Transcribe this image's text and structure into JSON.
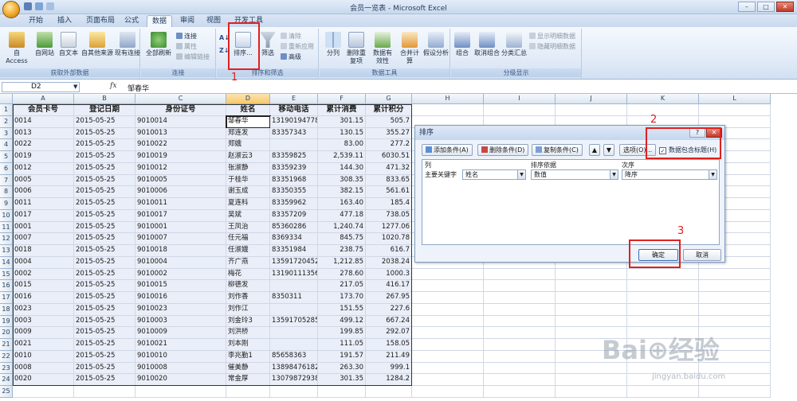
{
  "window": {
    "title": "会员一览表 - Microsoft Excel"
  },
  "ribbon_tabs": [
    "开始",
    "插入",
    "页面布局",
    "公式",
    "数据",
    "审阅",
    "视图",
    "开发工具"
  ],
  "active_tab": "数据",
  "ribbon": {
    "groups": {
      "external": "获取外部数据",
      "connections": "连接",
      "sortfilter": "排序和筛选",
      "datatools": "数据工具",
      "outline": "分级显示"
    },
    "buttons": {
      "from_access": "自 Access",
      "from_web": "自网站",
      "from_text": "自文本",
      "from_other": "自其他来源",
      "existing": "现有连接",
      "refresh_all": "全部刷新",
      "connections": "连接",
      "properties": "属性",
      "edit_links": "编辑链接",
      "sort": "排序...",
      "filter": "筛选",
      "clear": "清除",
      "reapply": "重新应用",
      "advanced": "高级",
      "split": "分列",
      "remove_dup": "删除重复项",
      "validation": "数据有效性",
      "consolidate": "合并计算",
      "whatif": "假设分析",
      "group": "组合",
      "ungroup": "取消组合",
      "subtotal": "分类汇总",
      "show_detail": "显示明细数据",
      "hide_detail": "隐藏明细数据"
    }
  },
  "formula_bar": {
    "name_box": "D2",
    "fx": "fx",
    "content": "邹春华"
  },
  "columns": [
    "A",
    "B",
    "C",
    "D",
    "E",
    "F",
    "G",
    "H",
    "I",
    "J",
    "K",
    "L"
  ],
  "headers": [
    "会员卡号",
    "登记日期",
    "身份证号",
    "姓名",
    "移动电话",
    "累计消费",
    "累计积分"
  ],
  "rows": [
    [
      "0014",
      "2015-05-25",
      "9010014",
      "邹春华",
      "13190194778",
      "301.15",
      "505.7"
    ],
    [
      "0013",
      "2015-05-25",
      "9010013",
      "郑连发",
      "83357343",
      "130.15",
      "355.27"
    ],
    [
      "0022",
      "2015-05-25",
      "9010022",
      "郑娥",
      "",
      "83.00",
      "277.2"
    ],
    [
      "0019",
      "2015-05-25",
      "9010019",
      "赵淑云3",
      "83359825",
      "2,539.11",
      "6030.51"
    ],
    [
      "0012",
      "2015-05-25",
      "9010012",
      "张淑静",
      "83359239",
      "144.30",
      "471.32"
    ],
    [
      "0005",
      "2015-05-25",
      "9010005",
      "于桂华",
      "83351968",
      "308.35",
      "833.65"
    ],
    [
      "0006",
      "2015-05-25",
      "9010006",
      "谢玉成",
      "83350355",
      "382.15",
      "561.61"
    ],
    [
      "0011",
      "2015-05-25",
      "9010011",
      "夏连科",
      "83359962",
      "163.40",
      "185.4"
    ],
    [
      "0017",
      "2015-05-25",
      "9010017",
      "吴斌",
      "83357209",
      "477.18",
      "738.05"
    ],
    [
      "0001",
      "2015-05-25",
      "9010001",
      "王凤治",
      "85360286",
      "1,240.74",
      "1277.06"
    ],
    [
      "0007",
      "2015-05-25",
      "9010007",
      "任元福",
      "8369334",
      "845.75",
      "1020.78"
    ],
    [
      "0018",
      "2015-05-25",
      "9010018",
      "任淑娥",
      "83351984",
      "238.75",
      "616.7"
    ],
    [
      "0004",
      "2015-05-25",
      "9010004",
      "齐广燕",
      "13591720452",
      "1,212.85",
      "2038.24"
    ],
    [
      "0002",
      "2015-05-25",
      "9010002",
      "梅花",
      "13190111356",
      "278.60",
      "1000.3"
    ],
    [
      "0015",
      "2015-05-25",
      "9010015",
      "柳德发",
      "",
      "217.05",
      "416.17"
    ],
    [
      "0016",
      "2015-05-25",
      "9010016",
      "刘作香",
      "8350311",
      "173.70",
      "267.95"
    ],
    [
      "0023",
      "2015-05-25",
      "9010023",
      "刘作江",
      "",
      "151.55",
      "227.6"
    ],
    [
      "0003",
      "2015-05-25",
      "9010003",
      "刘金玲3",
      "13591705285",
      "499.12",
      "667.24"
    ],
    [
      "0009",
      "2015-05-25",
      "9010009",
      "刘洪桥",
      "",
      "199.85",
      "292.07"
    ],
    [
      "0021",
      "2015-05-25",
      "9010021",
      "刘本刚",
      "",
      "111.05",
      "158.05"
    ],
    [
      "0010",
      "2015-05-25",
      "9010010",
      "李兆勤1",
      "85658363",
      "191.57",
      "211.49"
    ],
    [
      "0008",
      "2015-05-25",
      "9010008",
      "催美静",
      "13898476182",
      "263.30",
      "999.1"
    ],
    [
      "0020",
      "2015-05-25",
      "9010020",
      "常金厚",
      "13079872938",
      "301.35",
      "1284.2"
    ]
  ],
  "row_numbers": [
    "1",
    "2",
    "3",
    "4",
    "5",
    "6",
    "7",
    "8",
    "9",
    "10",
    "11",
    "12",
    "13",
    "14",
    "15",
    "16",
    "17",
    "18",
    "19",
    "20",
    "21",
    "22",
    "23",
    "24",
    "25"
  ],
  "dialog": {
    "title": "排序",
    "add_level": "添加条件(A)",
    "delete_level": "删除条件(D)",
    "copy_level": "复制条件(C)",
    "options": "选项(O)...",
    "has_headers": "数据包含标题(H)",
    "col_header": "列",
    "sort_on_header": "排序依据",
    "order_header": "次序",
    "primary_key": "主要关键字",
    "key_value": "姓名",
    "sort_on_value": "数值",
    "order_value": "降序",
    "ok": "确定",
    "cancel": "取消"
  },
  "annotations": {
    "one": "1",
    "two": "2",
    "three": "3"
  },
  "watermark": {
    "main": "Bai⊕经验",
    "sub": "jingyan.baidu.com"
  }
}
